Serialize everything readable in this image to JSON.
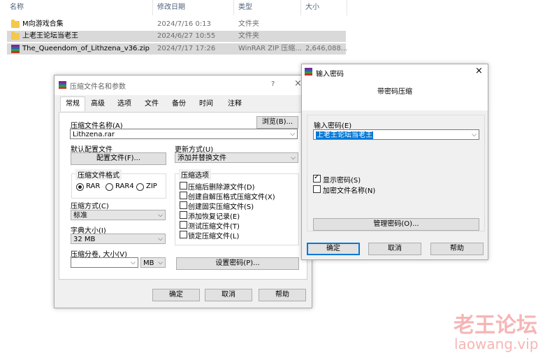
{
  "explorer": {
    "columns": {
      "name": "名称",
      "date": "修改日期",
      "type": "类型",
      "size": "大小"
    },
    "rows": [
      {
        "name": "M向游戏合集",
        "date": "2024/7/16 0:13",
        "type": "文件夹",
        "size": "",
        "icon": "folder-icon"
      },
      {
        "name": "上老王论坛当老王",
        "date": "2024/6/27 10:55",
        "type": "文件夹",
        "size": "",
        "icon": "folder-icon"
      },
      {
        "name": "The_Queendom_of_Lithzena_v36.zip",
        "date": "2024/7/17 17:26",
        "type": "WinRAR ZIP 压缩...",
        "size": "2,646,088...",
        "icon": "winrar-zip-icon"
      }
    ]
  },
  "archive_dialog": {
    "title": "压缩文件名和参数",
    "help": "?",
    "close": "×",
    "tabs": [
      "常规",
      "高级",
      "选项",
      "文件",
      "备份",
      "时间",
      "注释"
    ],
    "archive_name_label": "压缩文件名称(A)",
    "browse": "浏览(B)...",
    "archive_name_value": "Lithzena.rar",
    "default_profile_label": "默认配置文件",
    "profiles_button": "配置文件(F)...",
    "update_mode_label": "更新方式(U)",
    "update_mode_value": "添加并替换文件",
    "format_group": "压缩文件格式",
    "formats": [
      "RAR",
      "RAR4",
      "ZIP"
    ],
    "selected_format": "RAR",
    "method_label": "压缩方式(C)",
    "method_value": "标准",
    "dict_label": "字典大小(I)",
    "dict_value": "32 MB",
    "split_label": "压缩分卷, 大小(V)",
    "split_value": "",
    "split_unit": "MB",
    "options_group": "压缩选项",
    "options": [
      {
        "label": "压缩后删除源文件(D)",
        "checked": false
      },
      {
        "label": "创建自解压格式压缩文件(X)",
        "checked": false
      },
      {
        "label": "创建固实压缩文件(S)",
        "checked": false
      },
      {
        "label": "添加恢复记录(E)",
        "checked": false
      },
      {
        "label": "测试压缩文件(T)",
        "checked": false
      },
      {
        "label": "锁定压缩文件(L)",
        "checked": false
      }
    ],
    "set_password": "设置密码(P)...",
    "ok": "确定",
    "cancel": "取消",
    "help_btn": "帮助"
  },
  "password_dialog": {
    "title": "输入密码",
    "close": "×",
    "heading": "带密码压缩",
    "password_label": "输入密码(E)",
    "password_value": "上老王论坛当老王",
    "show_password": {
      "label": "显示密码(S)",
      "checked": true
    },
    "encrypt_names": {
      "label": "加密文件名称(N)",
      "checked": false
    },
    "organize": "管理密码(O)...",
    "ok": "确定",
    "cancel": "取消",
    "help_btn": "帮助"
  },
  "watermark": {
    "cn": "老王论坛",
    "url": "laowang.vip"
  }
}
